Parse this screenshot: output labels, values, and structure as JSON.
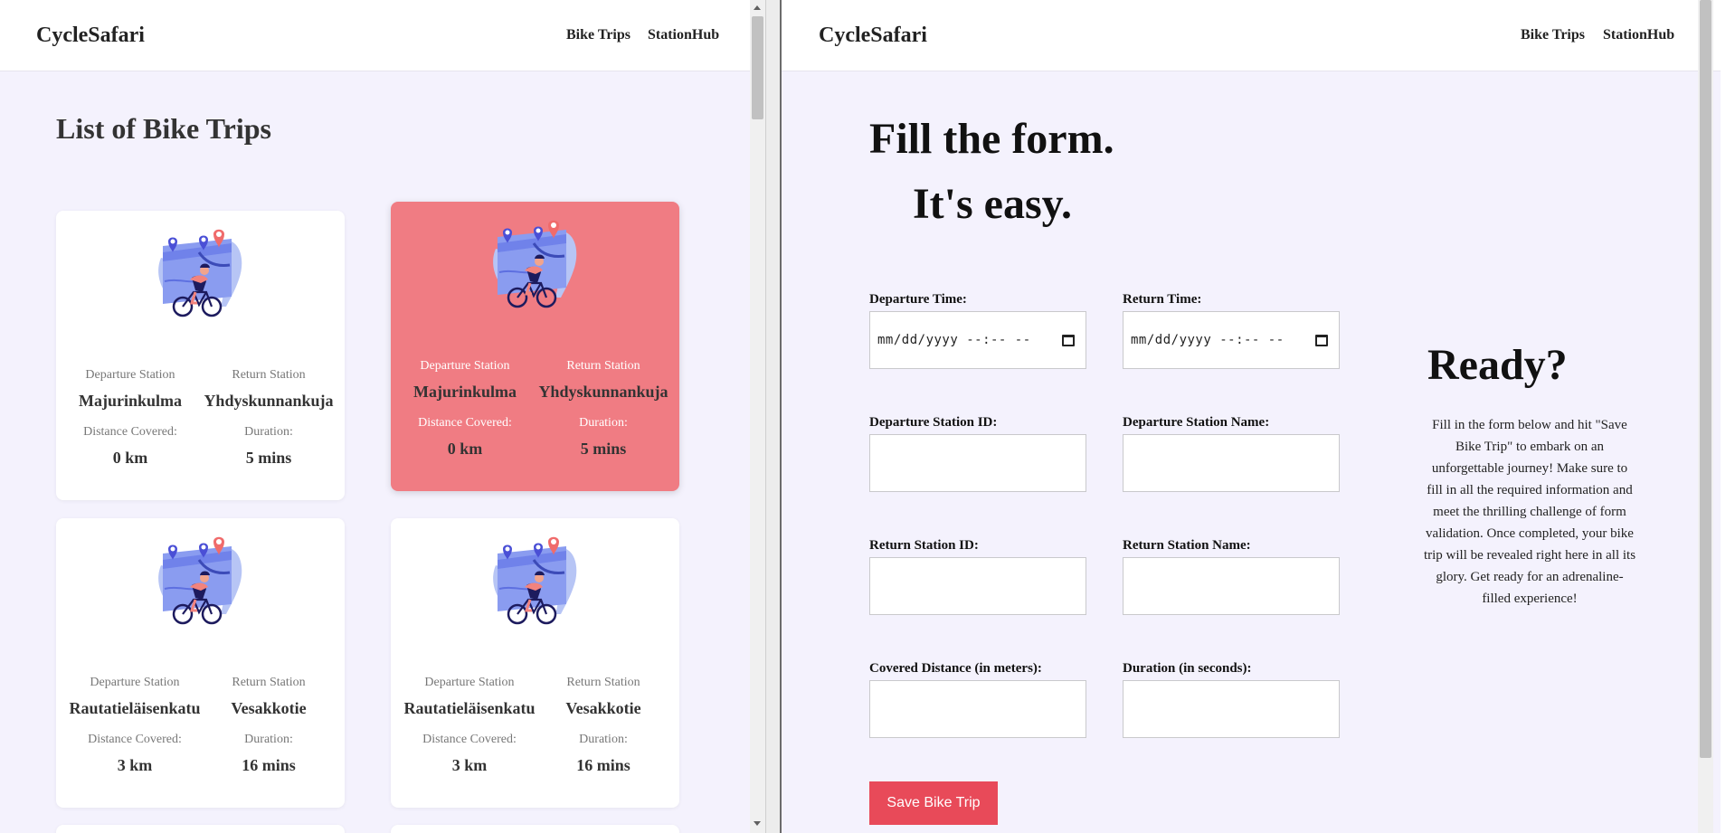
{
  "left": {
    "logo": "CycleSafari",
    "nav": [
      "Bike Trips",
      "StationHub"
    ],
    "title": "List of Bike Trips",
    "card_labels": {
      "departure": "Departure Station",
      "return": "Return Station",
      "distance": "Distance Covered:",
      "duration": "Duration:"
    },
    "trips": [
      {
        "departure": "Majurinkulma",
        "return": "Yhdyskunnankuja",
        "distance": "0 km",
        "duration": "5 mins"
      },
      {
        "departure": "Majurinkulma",
        "return": "Yhdyskunnankuja",
        "distance": "0 km",
        "duration": "5 mins"
      },
      {
        "departure": "Rautatieläisenkatu",
        "return": "Vesakkotie",
        "distance": "3 km",
        "duration": "16 mins"
      },
      {
        "departure": "Rautatieläisenkatu",
        "return": "Vesakkotie",
        "distance": "3 km",
        "duration": "16 mins"
      }
    ]
  },
  "right": {
    "logo": "CycleSafari",
    "nav": [
      "Bike Trips",
      "StationHub"
    ],
    "heading1": "Fill the form.",
    "heading2": "It's easy.",
    "fields": {
      "departure_time": {
        "label": "Departure Time:",
        "value": "mm/dd/yyyy --:-- --"
      },
      "return_time": {
        "label": "Return Time:",
        "value": "mm/dd/yyyy --:-- --"
      },
      "departure_station_id": {
        "label": "Departure Station ID:",
        "value": ""
      },
      "departure_station_name": {
        "label": "Departure Station Name:",
        "value": ""
      },
      "return_station_id": {
        "label": "Return Station ID:",
        "value": ""
      },
      "return_station_name": {
        "label": "Return Station Name:",
        "value": ""
      },
      "covered_distance": {
        "label": "Covered Distance (in meters):",
        "value": ""
      },
      "duration": {
        "label": "Duration (in seconds):",
        "value": ""
      }
    },
    "save_button": "Save Bike Trip",
    "ready_title": "Ready?",
    "ready_text": "Fill in the form below and hit \"Save Bike Trip\" to embark on an unforgettable journey! Make sure to fill in all the required information and meet the thrilling challenge of form validation. Once completed, your bike trip will be revealed right here in all its glory. Get ready for an adrenaline-filled experience!"
  },
  "colors": {
    "accent": "#e84a59",
    "highlight_card": "#f07c83",
    "page_bg": "#f4f2fd"
  }
}
